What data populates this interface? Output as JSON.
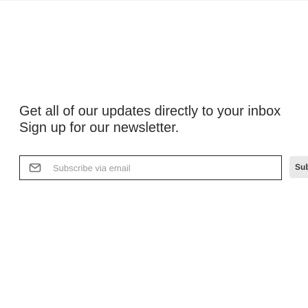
{
  "newsletter": {
    "headline_line1": "Get all of our updates directly to your inbox",
    "headline_line2": "Sign up for our newsletter.",
    "email_input": {
      "placeholder": "Subscribe via email",
      "value": "",
      "icon": "envelope-icon"
    },
    "submit_label": "Subscribe"
  }
}
